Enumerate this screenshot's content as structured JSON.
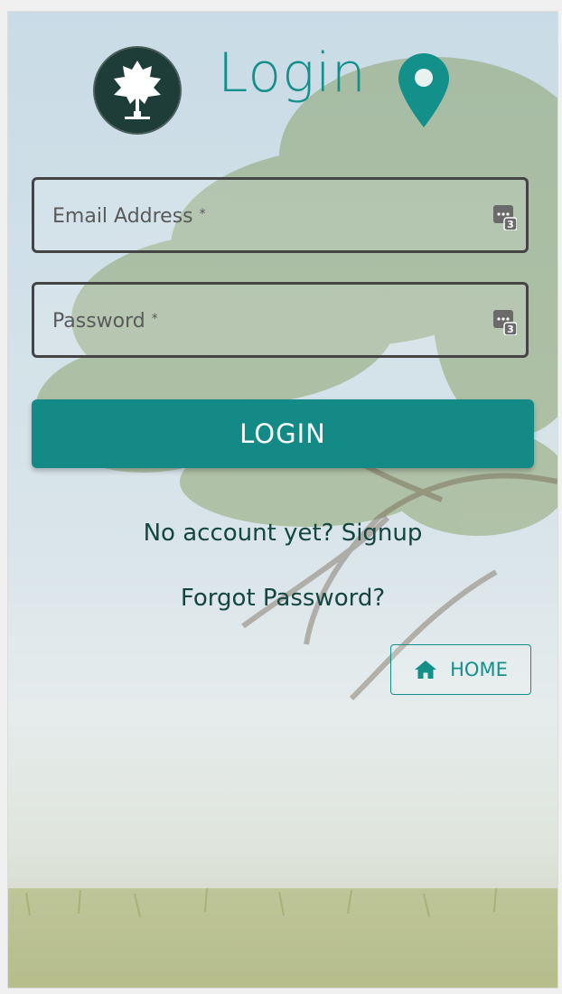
{
  "header": {
    "title": "Login",
    "logo_icon": "tree-logo-icon",
    "location_icon": "location-pin-icon"
  },
  "form": {
    "email": {
      "label": "Email Address",
      "required_mark": "*",
      "value": "",
      "icon": "keypad-icon"
    },
    "password": {
      "label": "Password",
      "required_mark": "*",
      "value": "",
      "icon": "keypad-icon"
    },
    "login_label": "LOGIN"
  },
  "links": {
    "signup": "No account yet? Signup",
    "forgot": "Forgot Password?"
  },
  "home_button": {
    "label": "HOME",
    "icon": "home-icon"
  },
  "colors": {
    "accent": "#14908a",
    "button": "#138a86",
    "logo_bg": "#1f3d38",
    "link_text": "#14463f"
  }
}
